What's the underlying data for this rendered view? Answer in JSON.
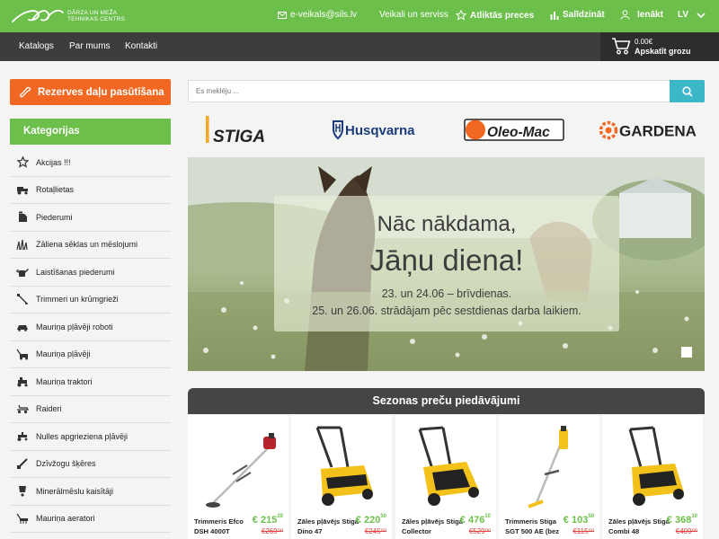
{
  "header": {
    "logo_line1": "Dārza un meža",
    "logo_line2": "tehnikas centrs",
    "email": "e-veikals@sils.lv",
    "stores": "Veikali un serviss",
    "wishlist": "Atliktās preces",
    "compare": "Salīdzināt",
    "login": "Ienākt",
    "language": "LV"
  },
  "nav": {
    "items": [
      "Katalogs",
      "Par mums",
      "Kontakti"
    ]
  },
  "cart": {
    "amount": "0.00€",
    "label": "Apskatīt grozu"
  },
  "sidebar": {
    "parts_button": "Rezerves daļu pasūtīšana",
    "categories_title": "Kategorijas",
    "categories": [
      {
        "label": "Akcijas !!!",
        "icon": "star-icon"
      },
      {
        "label": "Rotaļlietas",
        "icon": "toy-tractor-icon"
      },
      {
        "label": "Piederumi",
        "icon": "fuel-can-icon"
      },
      {
        "label": "Zāliena sēklas un mēslojumi",
        "icon": "grass-icon"
      },
      {
        "label": "Laistīšanas piederumi",
        "icon": "watering-can-icon"
      },
      {
        "label": "Trimmeri un krūmgrieži",
        "icon": "trimmer-icon"
      },
      {
        "label": "Mauriņa pļāvēji roboti",
        "icon": "robot-mower-icon"
      },
      {
        "label": "Mauriņa pļāvēji",
        "icon": "lawn-mower-icon"
      },
      {
        "label": "Mauriņa traktori",
        "icon": "lawn-tractor-icon"
      },
      {
        "label": "Raideri",
        "icon": "rider-icon"
      },
      {
        "label": "Nulles apgrieziena pļāvēji",
        "icon": "zero-turn-mower-icon"
      },
      {
        "label": "Dzīvžogu šķēres",
        "icon": "hedge-trimmer-icon"
      },
      {
        "label": "Minerālmēslu kaisītāji",
        "icon": "spreader-icon"
      },
      {
        "label": "Mauriņa aeratori",
        "icon": "aerator-icon"
      }
    ]
  },
  "search": {
    "placeholder": "Es meklēju ..."
  },
  "brands": [
    "STIGA",
    "Husqvarna",
    "Oleo-Mac",
    "GARDENA"
  ],
  "banner": {
    "line1": "Nāc nākdama,",
    "line2": "Jāņu diena!",
    "line3": "23. un 24.06 – brīvdienas.",
    "line4": "25. un 26.06. strādājam pēc sestdienas darba laikiem."
  },
  "season": {
    "title": "Sezonas preču piedāvājumi",
    "products": [
      {
        "name": "Trimmeris Efco DSH 4000T",
        "price_eur": "€ 215",
        "price_cents": "20",
        "old_price": "€269⁰⁰",
        "image": "trimmer-image"
      },
      {
        "name": "Zāles pļāvējs Stiga Dino 47",
        "price_eur": "€ 220",
        "price_cents": "50",
        "old_price": "€245⁰⁰",
        "image": "mower-image"
      },
      {
        "name": "Zāles pļāvējs Stiga Collector",
        "price_eur": "€ 476",
        "price_cents": "10",
        "old_price": "€529⁰⁰",
        "image": "mower-image"
      },
      {
        "name": "Trimmeris Stiga SGT 500 AE (bez",
        "price_eur": "€ 103",
        "price_cents": "50",
        "old_price": "€115⁰⁰",
        "image": "trimmer-image"
      },
      {
        "name": "Zāles pļāvējs Stiga Combi 48",
        "price_eur": "€ 368",
        "price_cents": "10",
        "old_price": "€409⁰⁰",
        "image": "mower-image"
      }
    ]
  },
  "colors": {
    "green": "#6cbf4a",
    "orange": "#f26722",
    "dark": "#3d3d3d",
    "teal": "#3cb7c8",
    "sale_red": "#e04040"
  }
}
